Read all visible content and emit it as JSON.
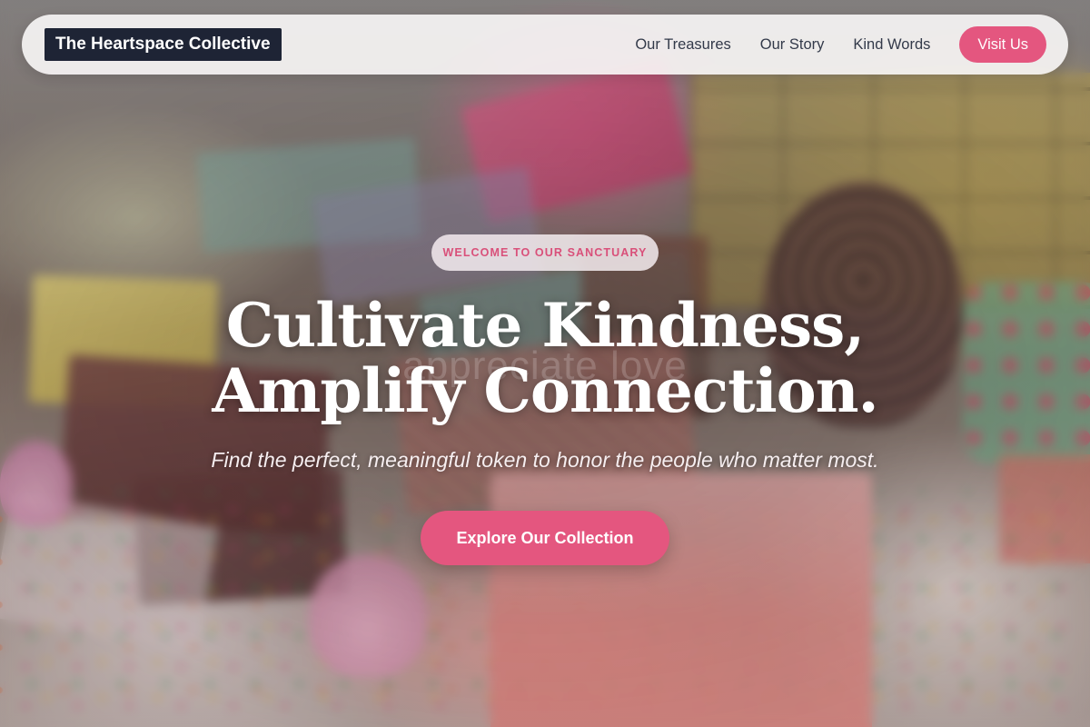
{
  "navbar": {
    "brand": "The Heartspace Collective",
    "links": [
      {
        "label": "Our Treasures"
      },
      {
        "label": "Our Story"
      },
      {
        "label": "Kind Words"
      }
    ],
    "cta_label": "Visit Us"
  },
  "hero": {
    "eyebrow": "WELCOME TO OUR SANCTUARY",
    "watermark": "appreciate love",
    "headline_line1": "Cultivate Kindness,",
    "headline_line2": "Amplify Connection.",
    "subtitle": "Find the perfect, meaningful token to honor the people who matter most.",
    "cta_label": "Explore Our Collection"
  },
  "colors": {
    "accent": "#e4567f",
    "brand_bg": "#1e2435",
    "nav_text": "#333a4a",
    "nav_bg": "#faf7f7"
  },
  "background_image": "blurred photo of handmade soaps, wrapped gift boxes, a pinecone, meringues and colorful sprinkles"
}
